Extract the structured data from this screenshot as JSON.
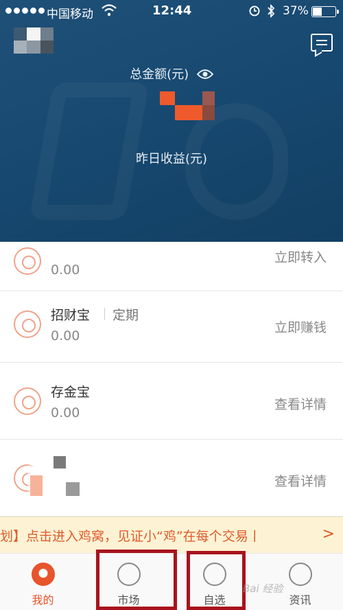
{
  "status_bar": {
    "carrier": "中国移动",
    "time": "12:44",
    "battery": "37%",
    "battery_level": 0.37
  },
  "header": {
    "total_label": "总金额(元)",
    "yesterday_label": "昨日收益(元)"
  },
  "products": [
    {
      "name": "",
      "value": "0.00",
      "action": "立即转入",
      "icon": "yen-icon"
    },
    {
      "name": "招财宝",
      "tag": "定期",
      "value": "0.00",
      "action": "立即赚钱",
      "icon": "ingot-icon"
    },
    {
      "name": "存金宝",
      "value": "0.00",
      "action": "查看详情",
      "icon": "gold-icon"
    },
    {
      "name": "",
      "value": "",
      "action": "查看详情",
      "icon": "chart-icon"
    }
  ],
  "banner": {
    "text": "划】点击进入鸡窝，见证小“鸡”在每个交易丨",
    "arrow": ">"
  },
  "tabs": [
    {
      "label": "我的",
      "active": true,
      "icon": "mine-icon"
    },
    {
      "label": "市场",
      "active": false,
      "icon": "market-icon"
    },
    {
      "label": "自选",
      "active": false,
      "icon": "star-icon"
    },
    {
      "label": "资讯",
      "active": false,
      "icon": "news-icon"
    }
  ],
  "watermark": "Bai 经验",
  "colors": {
    "header_bg": "#1a4a72",
    "accent": "#e8542b",
    "banner_bg": "#fdf3d4",
    "highlight_box": "#a8121d"
  }
}
